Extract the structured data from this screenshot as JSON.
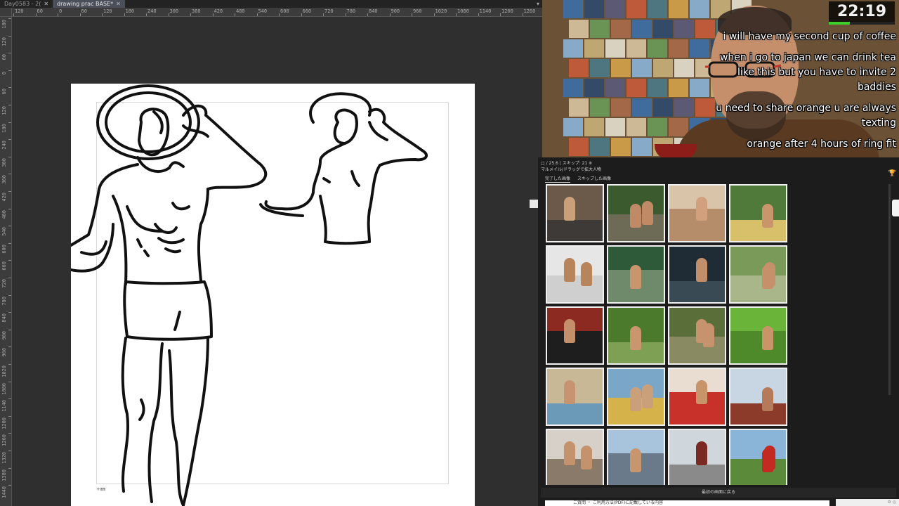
{
  "tabs": [
    {
      "label": "Day0583 - 2(",
      "active": false
    },
    {
      "label": "drawing prac BASE*",
      "active": true
    }
  ],
  "tab_more": "▾",
  "ruler": {
    "h_labels": [
      "120",
      "60",
      "0",
      "60",
      "120",
      "180",
      "240",
      "300",
      "360",
      "420",
      "480",
      "540",
      "600",
      "660",
      "720",
      "780",
      "840",
      "900",
      "960",
      "1020",
      "1080",
      "1140",
      "1200",
      "1260"
    ],
    "v_labels": [
      "180",
      "120",
      "60",
      "0",
      "60",
      "120",
      "180",
      "240",
      "300",
      "360",
      "420",
      "480",
      "540",
      "600",
      "660",
      "720",
      "780",
      "840",
      "900",
      "960",
      "1020",
      "1080",
      "1140",
      "1200",
      "1260",
      "1320",
      "1380",
      "1440"
    ]
  },
  "canvas": {
    "corner_mark": "+㎜"
  },
  "stream": {
    "timer": "22:19",
    "timer_progress": 0.32,
    "chat": [
      "i will have my second cup of coffee",
      "when i go to japan we can drink tea like this but you have to invite 2 baddies",
      "u need to share orange u are always texting",
      "orange after 4 hours of ring fit"
    ]
  },
  "browser": {
    "header_line1": "□ / 25.6 | スキップ: 21 ※",
    "header_line2": "マルメイル/ドラッグで拡大人物",
    "tabs": [
      "完了した画像",
      "スキップした画像"
    ],
    "side_icon": "🏆",
    "footer": "最初の画面に戻る",
    "bottom_text": "ご質問 ・ ご利用方法(PDF)に記載している内容",
    "corner_text": "⚙ ◎",
    "tiles": [
      {
        "name": "tile-man-striking-pose-ruins",
        "c1": "#6b5a4a",
        "c2": "#3d3a37",
        "fig": "#caa07a"
      },
      {
        "name": "tile-man-sitting-rocks",
        "c1": "#3b5a2e",
        "c2": "#6d6a56",
        "fig": "#c08a66"
      },
      {
        "name": "tile-two-men-chairs",
        "c1": "#d9c4aa",
        "c2": "#b58d6a",
        "fig": "#d2a07c"
      },
      {
        "name": "tile-two-men-straw-hats",
        "c1": "#4f7a3a",
        "c2": "#d8c06a",
        "fig": "#c9966c"
      },
      {
        "name": "tile-man-studio-stretch",
        "c1": "#e6e6e6",
        "c2": "#cfcfcf",
        "fig": "#b7845c"
      },
      {
        "name": "tile-man-by-river",
        "c1": "#2f5a3a",
        "c2": "#6e8a6a",
        "fig": "#c8956d"
      },
      {
        "name": "tile-man-steel-frame",
        "c1": "#1f2c35",
        "c2": "#3a4a55",
        "fig": "#c28f6a"
      },
      {
        "name": "tile-man-rice-field",
        "c1": "#7a9a5a",
        "c2": "#a8b68a",
        "fig": "#c6916a"
      },
      {
        "name": "tile-men-torii-gate",
        "c1": "#8c2a22",
        "c2": "#1e1e1e",
        "fig": "#c4906c"
      },
      {
        "name": "tile-man-forest-stance",
        "c1": "#4c7a2c",
        "c2": "#7ea054",
        "fig": "#c9966e"
      },
      {
        "name": "tile-two-men-path",
        "c1": "#5a6e3a",
        "c2": "#8a8a62",
        "fig": "#c6936e"
      },
      {
        "name": "tile-man-grass-kneel",
        "c1": "#6ab43a",
        "c2": "#4e8a2a",
        "fig": "#c89568"
      },
      {
        "name": "tile-men-pushups-beach",
        "c1": "#c8b896",
        "c2": "#6a9ab8",
        "fig": "#c69470"
      },
      {
        "name": "tile-man-yoga-deck",
        "c1": "#7aa6c8",
        "c2": "#d6b24a",
        "fig": "#caa07a"
      },
      {
        "name": "tile-man-floor-room",
        "c1": "#e8ddd0",
        "c2": "#c8302a",
        "fig": "#c8946a"
      },
      {
        "name": "tile-slide-sky",
        "c1": "#c8d6e4",
        "c2": "#8c3a2a",
        "fig": "#b57a5a"
      },
      {
        "name": "tile-man-writing-desk",
        "c1": "#d6d0c8",
        "c2": "#8a7a6a",
        "fig": "#c4926c"
      },
      {
        "name": "tile-men-rocks-sky",
        "c1": "#a8c4dc",
        "c2": "#6a7a8a",
        "fig": "#c8966e"
      },
      {
        "name": "tile-men-bridge",
        "c1": "#cfd6dc",
        "c2": "#8a8a8a",
        "fig": "#7a2a22"
      },
      {
        "name": "tile-people-field",
        "c1": "#8ab4d8",
        "c2": "#5a8a3a",
        "fig": "#c22a22"
      }
    ]
  }
}
